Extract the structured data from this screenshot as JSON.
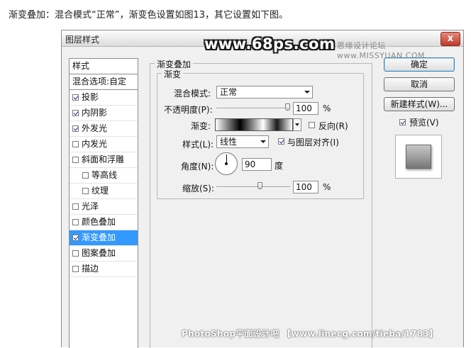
{
  "caption": "渐变叠加：混合模式“正常”，渐变色设置如图13，其它设置如下图。",
  "watermark": {
    "logo": "www.68ps.com",
    "site": "思缘设计论坛 www.MISSYUAN.COM",
    "footer": "PhotoShop平面设计吧 【www.linecg.com/tieba/1783】"
  },
  "window": {
    "title": "图层样式",
    "close_label": "x"
  },
  "style_list": {
    "header": "样式",
    "blend_options": "混合选项:自定",
    "items": [
      {
        "label": "投影",
        "checked": true
      },
      {
        "label": "内阴影",
        "checked": true
      },
      {
        "label": "外发光",
        "checked": true
      },
      {
        "label": "内发光",
        "checked": false
      },
      {
        "label": "斜面和浮雕",
        "checked": false
      },
      {
        "label": "等高线",
        "checked": false
      },
      {
        "label": "纹理",
        "checked": false
      },
      {
        "label": "光泽",
        "checked": false
      },
      {
        "label": "颜色叠加",
        "checked": false
      },
      {
        "label": "渐变叠加",
        "checked": true
      },
      {
        "label": "图案叠加",
        "checked": false
      },
      {
        "label": "描边",
        "checked": false
      }
    ]
  },
  "panel": {
    "section_title": "渐变叠加",
    "group_title": "渐变",
    "blend_mode_label": "混合模式:",
    "blend_mode_value": "正常",
    "opacity_label": "不透明度(P):",
    "opacity_value": "100",
    "opacity_unit": "%",
    "opacity_level": 1.0,
    "gradient_label": "渐变:",
    "reverse_label": "反向(R)",
    "reverse_checked": false,
    "style_label": "样式(L):",
    "style_value": "线性",
    "align_label": "与图层对齐(I)",
    "align_checked": true,
    "angle_label": "角度(N):",
    "angle_value": "90",
    "angle_unit": "度",
    "scale_label": "缩放(S):",
    "scale_value": "100",
    "scale_unit": "%"
  },
  "buttons": {
    "ok": "确定",
    "cancel": "取消",
    "new_style": "新建样式(W)...",
    "preview_label": "预览(V)",
    "preview_checked": true
  }
}
